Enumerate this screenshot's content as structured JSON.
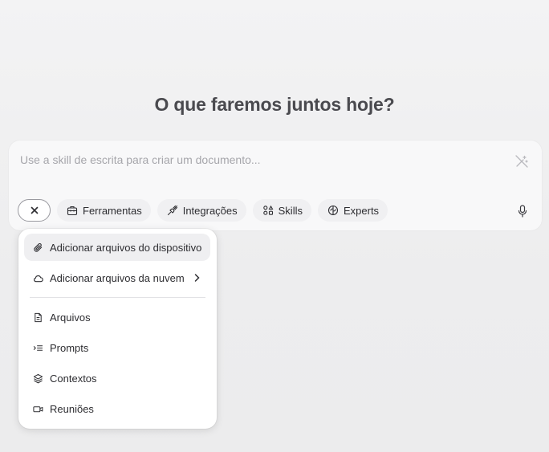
{
  "headline": "O que faremos juntos hoje?",
  "composer": {
    "placeholder": "Use a skill de escrita para criar um documento...",
    "wand_icon": "magic-wand-off-icon",
    "mic_icon": "microphone-icon"
  },
  "toolbar": {
    "close_icon": "close-icon",
    "chips": [
      {
        "label": "Ferramentas",
        "icon": "toolbox-icon"
      },
      {
        "label": "Integrações",
        "icon": "plug-icon"
      },
      {
        "label": "Skills",
        "icon": "skills-grid-icon"
      },
      {
        "label": "Experts",
        "icon": "brain-icon"
      }
    ]
  },
  "menu": {
    "items": [
      {
        "label": "Adicionar arquivos do dispositivo",
        "icon": "paperclip-icon",
        "active": true
      },
      {
        "label": "Adicionar arquivos da nuvem",
        "icon": "cloud-icon",
        "submenu": true
      },
      {
        "label": "Arquivos",
        "icon": "document-icon"
      },
      {
        "label": "Prompts",
        "icon": "prompt-list-icon"
      },
      {
        "label": "Contextos",
        "icon": "layers-icon"
      },
      {
        "label": "Reuniões",
        "icon": "video-camera-icon"
      }
    ]
  },
  "colors": {
    "background": "#efeff0",
    "surface": "#f8f8f9",
    "chip": "#f0f0f2",
    "active_item": "#efeff1",
    "text": "#2d2d31",
    "placeholder": "#a6a6ab",
    "headline": "#4a4a4f"
  }
}
